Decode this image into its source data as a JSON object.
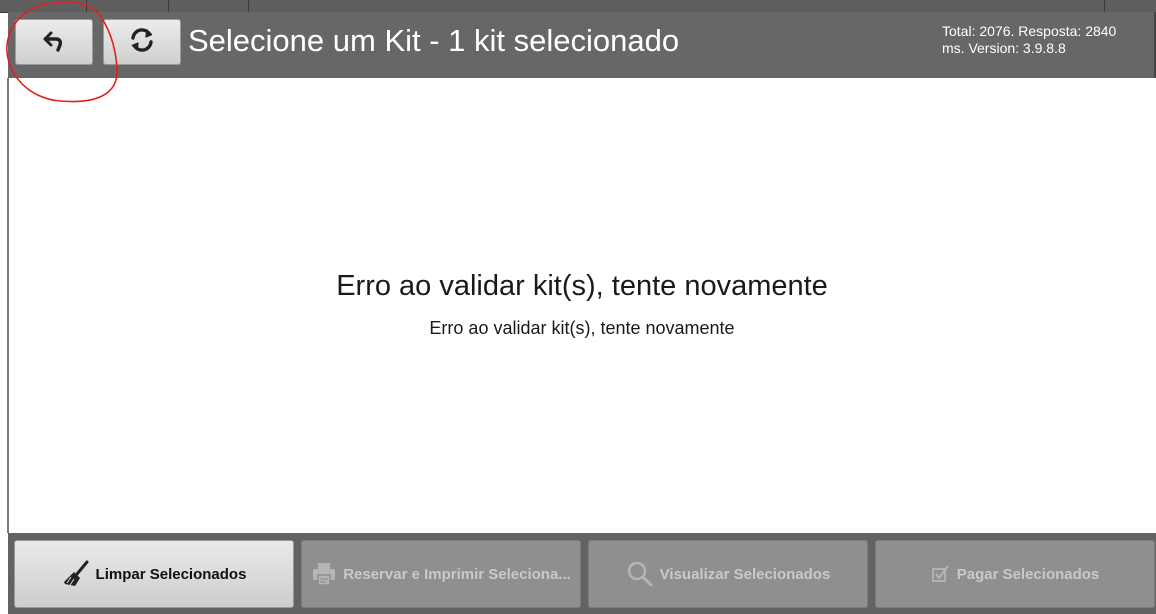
{
  "header": {
    "title": "Selecione um Kit - 1 kit selecionado",
    "info": "Total: 2076. Resposta: 2840 ms. Version: 3.9.8.8",
    "back_icon": "undo-arrow-icon",
    "refresh_icon": "refresh-icon"
  },
  "content": {
    "error_title": "Erro ao validar kit(s), tente novamente",
    "error_detail": "Erro ao validar kit(s), tente novamente"
  },
  "footer": {
    "buttons": [
      {
        "label": "Limpar Selecionados",
        "icon": "broom-icon",
        "enabled": true
      },
      {
        "label": "Reservar e Imprimir Seleciona...",
        "icon": "printer-icon",
        "enabled": false
      },
      {
        "label": "Visualizar Selecionados",
        "icon": "magnifier-icon",
        "enabled": false
      },
      {
        "label": "Pagar Selecionados",
        "icon": "checkbox-icon",
        "enabled": false
      }
    ]
  },
  "colors": {
    "header_bg": "#676767",
    "footer_bg": "#636363",
    "annotation": "#e02020"
  }
}
